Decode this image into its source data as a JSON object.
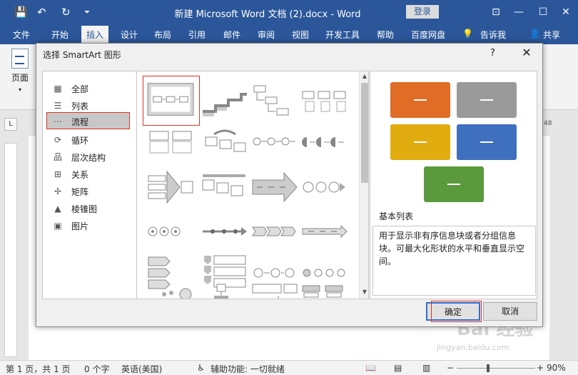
{
  "window": {
    "title": "新建 Microsoft Word 文档 (2).docx  -  Word",
    "signin": "登录",
    "minimize": "—",
    "restore": "☐",
    "close": "✕"
  },
  "quick_access": {
    "save": "💾",
    "undo": "↶",
    "redo": "↻",
    "customize": "⏷"
  },
  "menu": {
    "tabs": [
      "文件",
      "开始",
      "插入",
      "设计",
      "布局",
      "引用",
      "邮件",
      "审阅",
      "视图",
      "开发工具",
      "帮助",
      "百度网盘"
    ],
    "tell_me": "告诉我",
    "share": "共享",
    "active": "插入"
  },
  "ribbon": {
    "page_label": "页面"
  },
  "ruler": {
    "corner": "L",
    "number": "48"
  },
  "dialog": {
    "title": "选择 SmartArt 图形",
    "help": "?",
    "close": "✕",
    "categories": [
      {
        "label": "全部",
        "icon": "all-icon"
      },
      {
        "label": "列表",
        "icon": "list-icon"
      },
      {
        "label": "流程",
        "icon": "process-icon",
        "selected": true
      },
      {
        "label": "循环",
        "icon": "cycle-icon"
      },
      {
        "label": "层次结构",
        "icon": "hierarchy-icon"
      },
      {
        "label": "关系",
        "icon": "relationship-icon"
      },
      {
        "label": "矩阵",
        "icon": "matrix-icon"
      },
      {
        "label": "棱锥图",
        "icon": "pyramid-icon"
      },
      {
        "label": "图片",
        "icon": "picture-icon"
      }
    ],
    "preview": {
      "title": "基本列表",
      "description": "用于显示非有序信息块或者分组信息块。可最大化形状的水平和垂直显示空间。",
      "colors": [
        "#e06c26",
        "#9a9a9a",
        "#e0ac10",
        "#3f6fbf",
        "#5a9a3c"
      ]
    },
    "ok": "确定",
    "cancel": "取消"
  },
  "statusbar": {
    "page": "第 1 页，共 1 页",
    "words": "0 个字",
    "language": "英语(美国)",
    "accessibility": "辅助功能: 一切就绪",
    "zoom": "90%"
  },
  "watermark": {
    "text": "Bai 经验",
    "url": "jingyan.baidu.com"
  }
}
